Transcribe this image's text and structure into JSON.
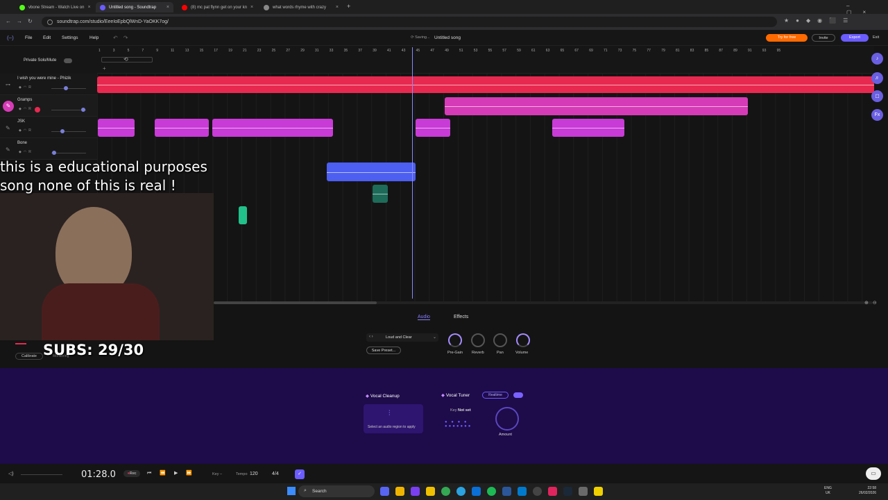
{
  "browser": {
    "tabs": [
      {
        "label": "vbone Stream - Watch Live on",
        "color": "#53fc18"
      },
      {
        "label": "Untitled song - Soundtrap",
        "color": "#6b5cff"
      },
      {
        "label": "(8) mc pat flynn get on your kn",
        "color": "#ff0000"
      },
      {
        "label": "what words rhyme with crazy",
        "color": "#888888"
      }
    ],
    "url": "soundtrap.com/studio/EeeIoEpbQlWnD-YaOKK7og/"
  },
  "app": {
    "menu": [
      "File",
      "Edit",
      "Settings",
      "Help"
    ],
    "saving": "Saving...",
    "song_title": "Untitled song",
    "try_free": "Try for free",
    "invite": "Invite",
    "export": "Export",
    "exit": "Exit",
    "private_solo": "Private Solo/Mute"
  },
  "ruler": [
    "1",
    "3",
    "5",
    "7",
    "9",
    "11",
    "13",
    "15",
    "17",
    "19",
    "21",
    "23",
    "25",
    "27",
    "29",
    "31",
    "33",
    "35",
    "37",
    "39",
    "41",
    "43",
    "45",
    "47",
    "49",
    "51",
    "53",
    "55",
    "57",
    "59",
    "61",
    "63",
    "65",
    "67",
    "69",
    "71",
    "73",
    "75",
    "77",
    "79",
    "81",
    "83",
    "85",
    "87",
    "89",
    "91",
    "93",
    "95"
  ],
  "tracks": [
    {
      "name": "I wish you were mine - Phizik",
      "color": "#e8294f"
    },
    {
      "name": "Gramps",
      "color": "#d63bb7"
    },
    {
      "name": "JSK",
      "color": "#c83bd6"
    },
    {
      "name": "Bone",
      "color": "#4c5ff0"
    }
  ],
  "overlay": {
    "line1": "this is a educational purposes",
    "line2": "song none of this is real !",
    "subs": "SUBS: 29/30"
  },
  "panel": {
    "tab_audio": "Audio",
    "tab_effects": "Effects",
    "preset": "Loud and Clear",
    "save_preset": "Save Preset...",
    "knobs": [
      "Pre-Gain",
      "Reverb",
      "Pan",
      "Volume"
    ],
    "calibrate": "Calibrate",
    "monitoring": "Monitoring"
  },
  "ai": {
    "vocal_cleanup": "Vocal Cleanup",
    "cleanup_hint": "Select an audio region to apply",
    "vocal_tuner": "Vocal Tuner",
    "realtime": "Realtime",
    "key_label": "Key",
    "key_value": "Not set",
    "amount": "Amount"
  },
  "transport": {
    "time": "01:28.0",
    "rec": "Rec",
    "key": "Key",
    "tempo_label": "Tempo",
    "tempo": "120",
    "meter": "4/4"
  },
  "taskbar": {
    "search": "Search",
    "lang": "ENG",
    "region": "UK",
    "clock": "22:58",
    "date": "26/02/2026"
  },
  "colors": {
    "accent": "#6b5cff",
    "brand_orange": "#ff6a00",
    "purple_panel": "#1e0b4a"
  }
}
